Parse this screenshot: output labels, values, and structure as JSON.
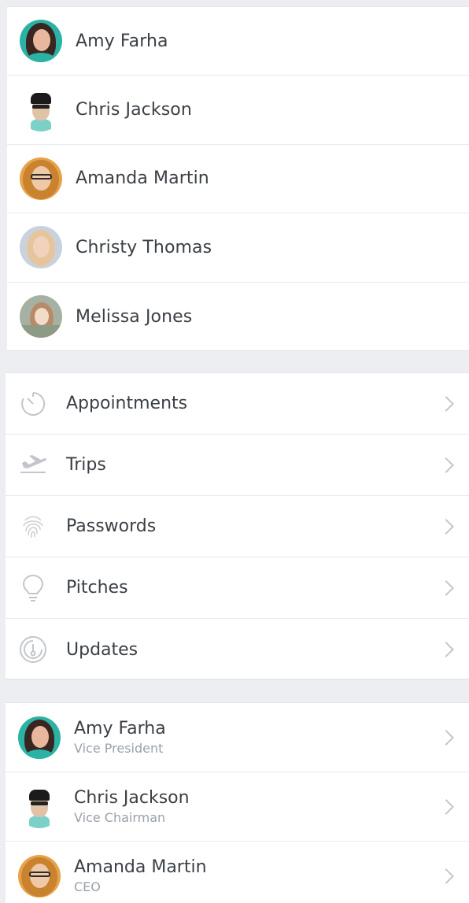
{
  "people": [
    {
      "name": "Amy Farha",
      "avatar": "amy"
    },
    {
      "name": "Chris Jackson",
      "avatar": "chris"
    },
    {
      "name": "Amanda Martin",
      "avatar": "amanda"
    },
    {
      "name": "Christy Thomas",
      "avatar": "christy"
    },
    {
      "name": "Melissa Jones",
      "avatar": "melissa"
    }
  ],
  "menu": [
    {
      "label": "Appointments",
      "icon": "timer-icon"
    },
    {
      "label": "Trips",
      "icon": "flight-takeoff-icon"
    },
    {
      "label": "Passwords",
      "icon": "fingerprint-icon"
    },
    {
      "label": "Pitches",
      "icon": "lightbulb-icon"
    },
    {
      "label": "Updates",
      "icon": "update-icon"
    }
  ],
  "contacts": [
    {
      "name": "Amy Farha",
      "title": "Vice President",
      "avatar": "amy"
    },
    {
      "name": "Chris Jackson",
      "title": "Vice Chairman",
      "avatar": "chris"
    },
    {
      "name": "Amanda Martin",
      "title": "CEO",
      "avatar": "amanda"
    }
  ],
  "colors": {
    "background": "#eceef2",
    "row": "#ffffff",
    "text": "#3b4046",
    "subtitle": "#9aa1a9",
    "icon": "#c2c6cc"
  }
}
